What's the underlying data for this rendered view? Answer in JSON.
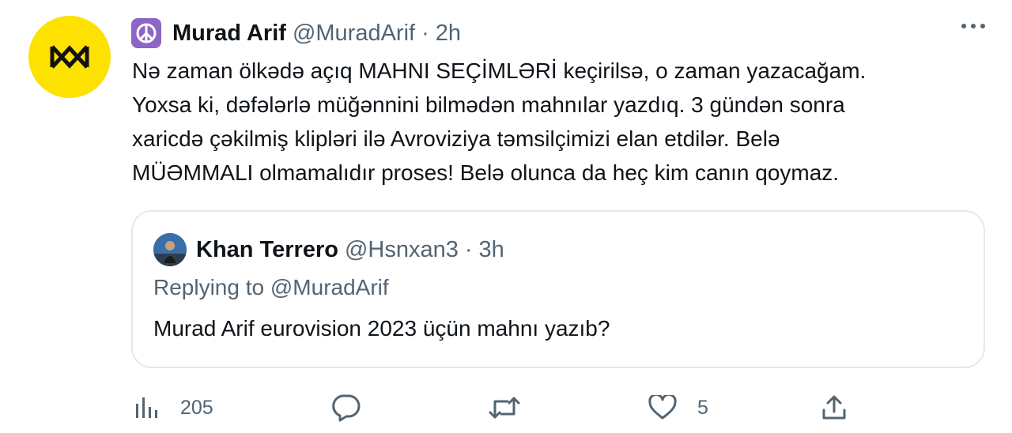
{
  "tweet": {
    "author_name": "Murad Arif",
    "author_handle": "@MuradArif",
    "separator": "·",
    "time": "2h",
    "body_lines": [
      "Nə zaman ölkədə açıq MAHNI SEÇİMLƏRİ keçirilsə, o zaman yazacağam.",
      "Yoxsa ki, dəfələrlə müğənnini bilmədən mahnılar yazdıq. 3 gündən sonra",
      "xaricdə çəkilmiş klipləri ilə Avroviziya təmsilçimizi elan etdilər. Belə",
      "MÜƏMMALI olmamalıdır proses! Belə olunca da heç kim canın qoymaz."
    ]
  },
  "quoted": {
    "author_name": "Khan Terrero",
    "author_handle": "@Hsnxan3",
    "separator": "·",
    "time": "3h",
    "reply_prefix": "Replying to",
    "reply_mention": "@MuradArif",
    "text": "Murad Arif eurovision 2023 üçün mahnı yazıb?"
  },
  "actions": {
    "views_count": "205",
    "likes_count": "5"
  },
  "icons": {
    "avatar": "crown-logo-icon",
    "badge": "peace-sign-icon",
    "more": "more-icon",
    "views": "views-icon",
    "reply": "reply-icon",
    "retweet": "retweet-icon",
    "like": "heart-icon",
    "share": "share-icon"
  },
  "colors": {
    "avatar_bg": "#fde100",
    "badge_bg": "#8c65c5",
    "secondary_text": "#536471",
    "primary_text": "#0f1419",
    "border": "#e4e8eb"
  }
}
